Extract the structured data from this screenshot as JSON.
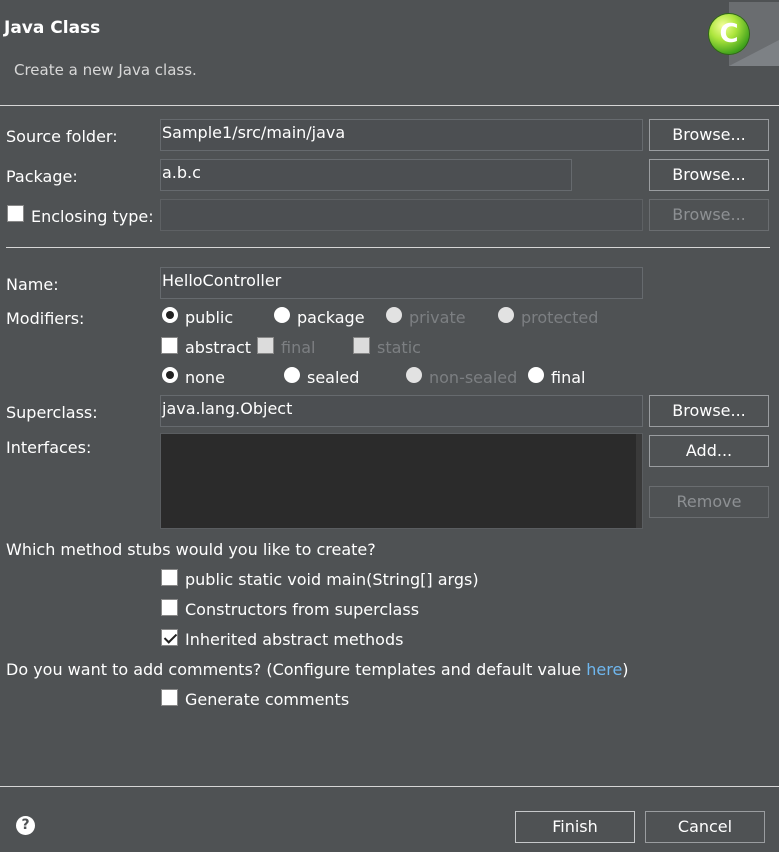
{
  "header": {
    "title": "Java Class",
    "subtitle": "Create a new Java class.",
    "logo_glyph": "C"
  },
  "source_folder": {
    "label": "Source folder:",
    "value": "Sample1/src/main/java",
    "browse": "Browse..."
  },
  "package": {
    "label": "Package:",
    "value": "a.b.c",
    "browse": "Browse..."
  },
  "enclosing": {
    "label": "Enclosing type:",
    "value": "",
    "browse": "Browse...",
    "checked": false
  },
  "name": {
    "label": "Name:",
    "value": "HelloController"
  },
  "modifiers": {
    "label": "Modifiers:",
    "access": [
      "public",
      "package",
      "private",
      "protected"
    ],
    "abstract": "abstract",
    "final": "final",
    "static": "static",
    "sealing": [
      "none",
      "sealed",
      "non-sealed",
      "final"
    ]
  },
  "superclass": {
    "label": "Superclass:",
    "value": "java.lang.Object",
    "browse": "Browse..."
  },
  "interfaces": {
    "label": "Interfaces:",
    "add": "Add...",
    "remove": "Remove"
  },
  "stubs": {
    "question": "Which method stubs would you like to create?",
    "main": "public static void main(String[] args)",
    "constructors": "Constructors from superclass",
    "inherited": "Inherited abstract methods"
  },
  "comments": {
    "question": "Do you want to add comments? (Configure templates and default value ",
    "link": "here",
    "close": ")",
    "generate": "Generate comments"
  },
  "footer": {
    "finish": "Finish",
    "cancel": "Cancel",
    "help": "?"
  }
}
